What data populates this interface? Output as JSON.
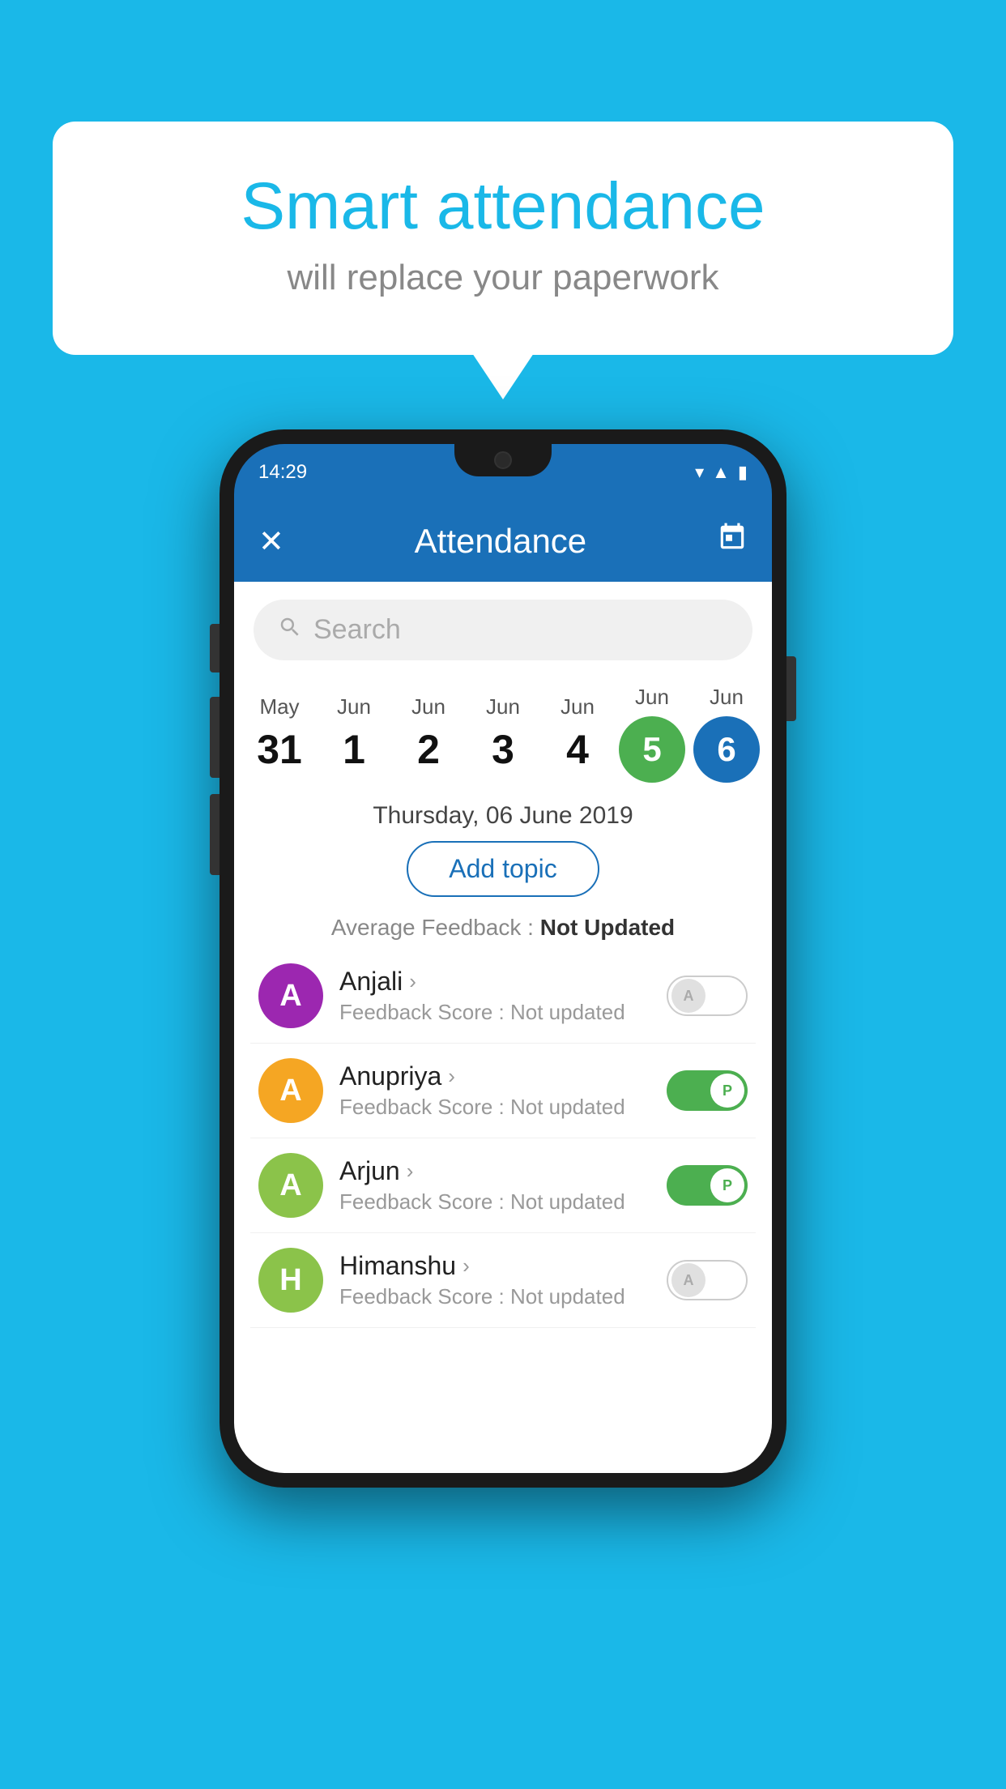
{
  "background_color": "#1ab8e8",
  "bubble": {
    "title": "Smart attendance",
    "subtitle": "will replace your paperwork"
  },
  "phone": {
    "status_bar": {
      "time": "14:29",
      "icons": [
        "wifi",
        "signal",
        "battery"
      ]
    },
    "app_bar": {
      "close_label": "✕",
      "title": "Attendance",
      "calendar_icon": "📅"
    },
    "search": {
      "placeholder": "Search"
    },
    "dates": [
      {
        "month": "May",
        "day": "31",
        "style": "normal"
      },
      {
        "month": "Jun",
        "day": "1",
        "style": "normal"
      },
      {
        "month": "Jun",
        "day": "2",
        "style": "normal"
      },
      {
        "month": "Jun",
        "day": "3",
        "style": "normal"
      },
      {
        "month": "Jun",
        "day": "4",
        "style": "normal"
      },
      {
        "month": "Jun",
        "day": "5",
        "style": "green"
      },
      {
        "month": "Jun",
        "day": "6",
        "style": "blue"
      }
    ],
    "selected_date": "Thursday, 06 June 2019",
    "add_topic_label": "Add topic",
    "avg_feedback_label": "Average Feedback :",
    "avg_feedback_value": "Not Updated",
    "students": [
      {
        "name": "Anjali",
        "avatar_letter": "A",
        "avatar_color": "purple",
        "feedback": "Feedback Score : Not updated",
        "toggle": "off",
        "toggle_letter": "A"
      },
      {
        "name": "Anupriya",
        "avatar_letter": "A",
        "avatar_color": "yellow",
        "feedback": "Feedback Score : Not updated",
        "toggle": "on",
        "toggle_letter": "P"
      },
      {
        "name": "Arjun",
        "avatar_letter": "A",
        "avatar_color": "green",
        "feedback": "Feedback Score : Not updated",
        "toggle": "on",
        "toggle_letter": "P"
      },
      {
        "name": "Himanshu",
        "avatar_letter": "H",
        "avatar_color": "light-green",
        "feedback": "Feedback Score : Not updated",
        "toggle": "off",
        "toggle_letter": "A"
      }
    ]
  }
}
